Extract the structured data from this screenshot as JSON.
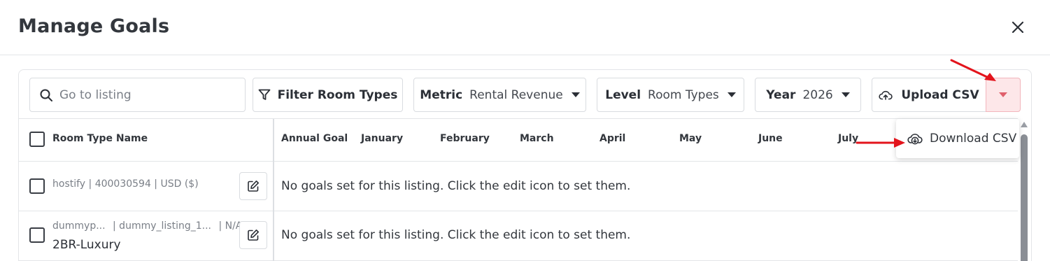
{
  "header": {
    "title": "Manage Goals",
    "close_icon": "close-icon"
  },
  "toolbar": {
    "search": {
      "placeholder": "Go to listing",
      "icon": "search-icon"
    },
    "filter_label": "Filter Room Types",
    "metric": {
      "label": "Metric",
      "value": "Rental Revenue"
    },
    "level": {
      "label": "Level",
      "value": "Room Types"
    },
    "year": {
      "label": "Year",
      "value": "2026"
    },
    "upload_label": "Upload CSV",
    "split_caret_color": "#e0606c"
  },
  "dropdown": {
    "download_label": "Download CSV",
    "icon": "cloud-download-icon"
  },
  "table": {
    "name_header": "Room Type Name",
    "columns": [
      "Annual Goal",
      "January",
      "February",
      "March",
      "April",
      "May",
      "June",
      "July"
    ],
    "rows": [
      {
        "meta": "hostify | 400030594 | USD ($)",
        "name": "",
        "message": "No goals set for this listing. Click the edit icon to set them."
      },
      {
        "meta_a": "dummyp...",
        "meta_b": "| dummy_listing_1...",
        "meta_c": "| N/A",
        "name": "2BR-Luxury",
        "message": "No goals set for this listing. Click the edit icon to set them."
      }
    ]
  },
  "colors": {
    "annotation_arrow": "#e3141c",
    "split_bg": "#fde7e9"
  }
}
